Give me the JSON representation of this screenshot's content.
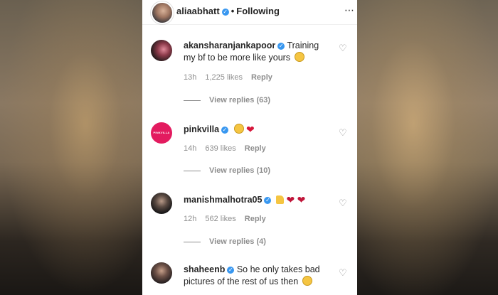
{
  "header": {
    "username": "aliaabhatt",
    "separator": "•",
    "following": "Following",
    "more_icon": "⋯"
  },
  "comments": [
    {
      "username": "akansharanjankapoor",
      "text": "Training my bf to be more like yours",
      "emoji": "😉",
      "time": "13h",
      "likes": "1,225 likes",
      "reply": "Reply",
      "view_replies": "View replies (63)"
    },
    {
      "username": "pinkvilla",
      "text": "",
      "emoji": "🤩❤",
      "avatar_text": "PINKVILLA",
      "time": "14h",
      "likes": "639 likes",
      "reply": "Reply",
      "view_replies": "View replies (10)"
    },
    {
      "username": "manishmalhotra05",
      "text": "",
      "emoji": "👍💔💔",
      "time": "12h",
      "likes": "562 likes",
      "reply": "Reply",
      "view_replies": "View replies (4)"
    },
    {
      "username": "shaheenb",
      "text": "So he only takes bad pictures of the rest of us then",
      "emoji": "😑",
      "time": "",
      "likes": "",
      "reply": "",
      "view_replies": ""
    }
  ],
  "colors": {
    "verified": "#3897f0",
    "muted": "#8e8e8e",
    "pinkvilla": "#e31b5f"
  }
}
